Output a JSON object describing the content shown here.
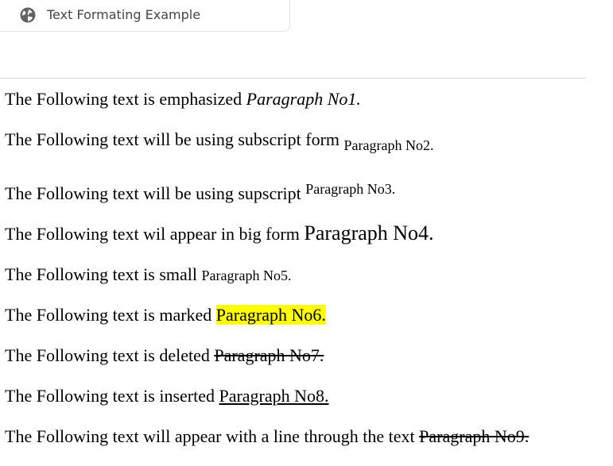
{
  "tab": {
    "title": "Text Formating Example",
    "icon": "globe-icon"
  },
  "lines": [
    {
      "prefix": "The Following text is emphasized ",
      "formatted": "Paragraph No1."
    },
    {
      "prefix": "The Following text will be using subscript form ",
      "formatted": "Paragraph No2."
    },
    {
      "prefix": "The Following text will be using supscript ",
      "formatted": "Paragraph No3."
    },
    {
      "prefix": "The Following text wil appear in big form ",
      "formatted": "Paragraph No4."
    },
    {
      "prefix": "The Following text is small ",
      "formatted": "Paragraph No5."
    },
    {
      "prefix": "The Following text is marked ",
      "formatted": "Paragraph No6."
    },
    {
      "prefix": "The Following text is deleted ",
      "formatted": "Paragraph No7."
    },
    {
      "prefix": "The Following text is inserted ",
      "formatted": "Paragraph No8."
    },
    {
      "prefix": "The Following text will appear with a line through the text ",
      "formatted": "Paragraph No9."
    }
  ],
  "colors": {
    "mark_highlight": "#ffff00",
    "tab_text": "#454545",
    "body_text": "#000000"
  }
}
